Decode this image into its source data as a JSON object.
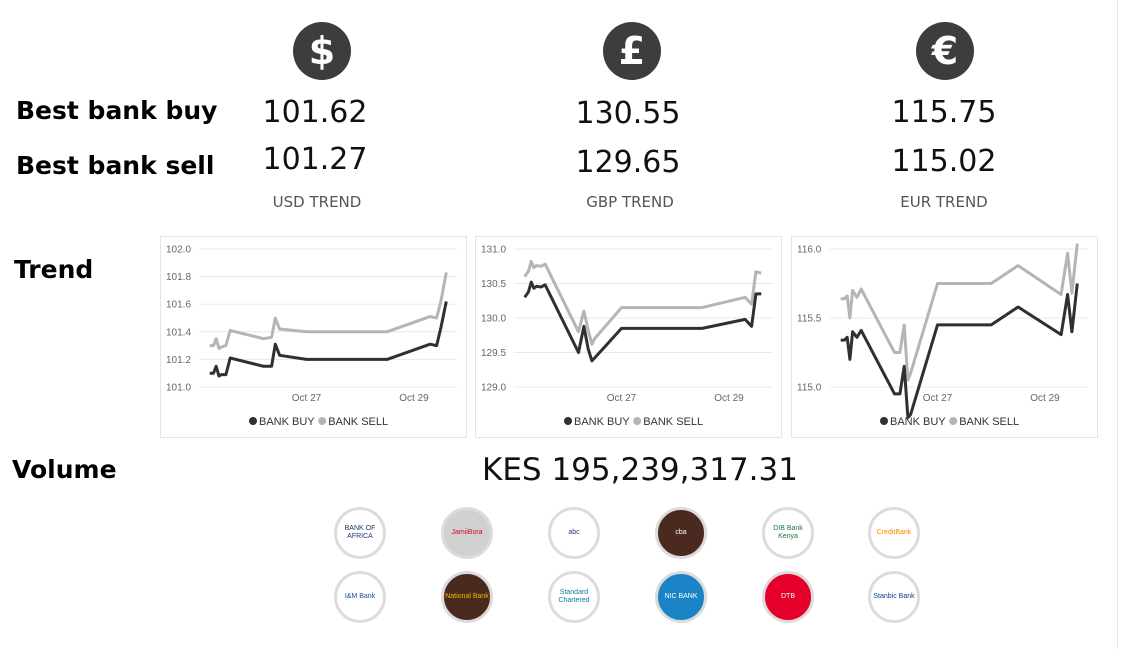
{
  "labels": {
    "best_buy": "Best bank buy",
    "best_sell": "Best bank sell",
    "trend": "Trend",
    "volume": "Volume"
  },
  "currencies": [
    {
      "symbol": "$",
      "icon": "dollar-icon",
      "buy": "101.62",
      "sell": "101.27",
      "trend_label": "USD TREND"
    },
    {
      "symbol": "£",
      "icon": "pound-icon",
      "buy": "130.55",
      "sell": "129.65",
      "trend_label": "GBP TREND"
    },
    {
      "symbol": "€",
      "icon": "euro-icon",
      "buy": "115.75",
      "sell": "115.02",
      "trend_label": "EUR TREND"
    }
  ],
  "volume_value": "KES 195,239,317.31",
  "colors": {
    "buy": "#303030",
    "sell": "#b5b5b5",
    "icon_bg": "#3d3d3d",
    "grid": "#e8e8e8"
  },
  "chart_data": [
    {
      "type": "line",
      "title": "USD TREND",
      "ylim": [
        101.0,
        102.0
      ],
      "yticks": [
        "101.0",
        "101.2",
        "101.4",
        "101.6",
        "101.8",
        "102.0"
      ],
      "xticks": [
        {
          "label": "Oct 27",
          "x": 27.0
        },
        {
          "label": "Oct 29",
          "x": 29.0
        }
      ],
      "x": [
        25.2,
        25.27,
        25.32,
        25.37,
        25.42,
        25.5,
        25.58,
        26.2,
        26.35,
        26.42,
        26.5,
        27.0,
        28.5,
        29.3,
        29.42,
        29.5,
        29.6
      ],
      "series": [
        {
          "name": "BANK BUY",
          "values": [
            101.1,
            101.1,
            101.15,
            101.08,
            101.09,
            101.09,
            101.21,
            101.15,
            101.15,
            101.31,
            101.23,
            101.2,
            101.2,
            101.31,
            101.3,
            101.43,
            101.62
          ]
        },
        {
          "name": "BANK SELL",
          "values": [
            101.3,
            101.3,
            101.35,
            101.28,
            101.29,
            101.3,
            101.41,
            101.35,
            101.36,
            101.5,
            101.42,
            101.4,
            101.4,
            101.51,
            101.5,
            101.62,
            101.83
          ]
        }
      ],
      "legend": "bottom"
    },
    {
      "type": "line",
      "title": "GBP TREND",
      "ylim": [
        129.0,
        131.0
      ],
      "yticks": [
        "129.0",
        "129.5",
        "130.0",
        "130.5",
        "131.0"
      ],
      "xticks": [
        {
          "label": "Oct 27",
          "x": 27.0
        },
        {
          "label": "Oct 29",
          "x": 29.0
        }
      ],
      "x": [
        25.2,
        25.27,
        25.32,
        25.37,
        25.42,
        25.5,
        25.58,
        26.2,
        26.3,
        26.38,
        26.45,
        26.5,
        27.0,
        28.5,
        29.3,
        29.42,
        29.5,
        29.6
      ],
      "series": [
        {
          "name": "BANK BUY",
          "values": [
            130.3,
            130.38,
            130.52,
            130.43,
            130.46,
            130.45,
            130.48,
            129.5,
            129.88,
            129.55,
            129.38,
            129.42,
            129.85,
            129.85,
            129.98,
            129.88,
            130.35,
            130.35
          ]
        },
        {
          "name": "BANK SELL",
          "values": [
            130.6,
            130.68,
            130.82,
            130.73,
            130.76,
            130.75,
            130.78,
            129.8,
            130.1,
            129.82,
            129.62,
            129.7,
            130.15,
            130.15,
            130.3,
            130.2,
            130.67,
            130.65
          ]
        }
      ],
      "legend": "bottom"
    },
    {
      "type": "line",
      "title": "EUR TREND",
      "ylim": [
        115.0,
        116.0
      ],
      "yticks": [
        "115.0",
        "115.5",
        "116.0"
      ],
      "xticks": [
        {
          "label": "Oct 27",
          "x": 27.0
        },
        {
          "label": "Oct 29",
          "x": 29.0
        }
      ],
      "x": [
        25.2,
        25.27,
        25.32,
        25.37,
        25.42,
        25.5,
        25.58,
        26.2,
        26.3,
        26.38,
        26.45,
        26.5,
        27.0,
        28.0,
        28.5,
        29.3,
        29.42,
        29.5,
        29.6
      ],
      "series": [
        {
          "name": "BANK BUY",
          "values": [
            115.34,
            115.34,
            115.36,
            115.2,
            115.4,
            115.36,
            115.41,
            114.95,
            114.95,
            115.15,
            114.78,
            114.8,
            115.45,
            115.45,
            115.58,
            115.38,
            115.67,
            115.4,
            115.75
          ]
        },
        {
          "name": "BANK SELL",
          "values": [
            115.64,
            115.64,
            115.66,
            115.5,
            115.7,
            115.65,
            115.71,
            115.25,
            115.25,
            115.45,
            115.05,
            115.1,
            115.75,
            115.75,
            115.88,
            115.67,
            115.97,
            115.68,
            116.04
          ]
        }
      ],
      "legend": "bottom"
    }
  ],
  "banks": [
    {
      "name": "Bank of Africa",
      "icon": "bank-of-africa-logo",
      "text": "BANK OF AFRICA"
    },
    {
      "name": "Jamii Bora Bank",
      "icon": "jamii-bora-logo",
      "text": "JamiiBora"
    },
    {
      "name": "ABC Bank",
      "icon": "abc-bank-logo",
      "text": "abc"
    },
    {
      "name": "CBA",
      "icon": "cba-logo",
      "text": "cba"
    },
    {
      "name": "DIB Bank Kenya",
      "icon": "dib-bank-logo",
      "text": "DIB Bank Kenya"
    },
    {
      "name": "Credit Bank",
      "icon": "credit-bank-logo",
      "text": "CreditBank"
    },
    {
      "name": "I&M Bank",
      "icon": "im-bank-logo",
      "text": "I&M Bank"
    },
    {
      "name": "National Bank",
      "icon": "national-bank-logo",
      "text": "National Bank"
    },
    {
      "name": "Standard Chartered",
      "icon": "standard-chartered-logo",
      "text": "Standard Chartered"
    },
    {
      "name": "NIC Bank",
      "icon": "nic-bank-logo",
      "text": "NIC BANK"
    },
    {
      "name": "DTB",
      "icon": "dtb-logo",
      "text": "DTB"
    },
    {
      "name": "Stanbic Bank",
      "icon": "stanbic-bank-logo",
      "text": "Stanbic Bank"
    }
  ]
}
